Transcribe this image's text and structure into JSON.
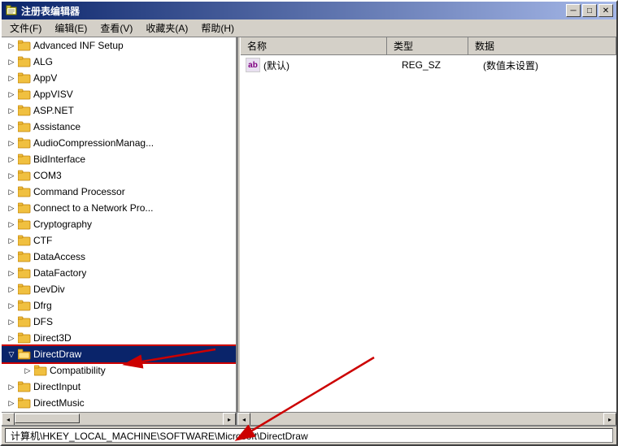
{
  "window": {
    "title": "注册表编辑器",
    "icon": "🗂"
  },
  "menu": {
    "items": [
      {
        "label": "文件(F)"
      },
      {
        "label": "编辑(E)"
      },
      {
        "label": "查看(V)"
      },
      {
        "label": "收藏夹(A)"
      },
      {
        "label": "帮助(H)"
      }
    ]
  },
  "tree": {
    "items": [
      {
        "label": "Advanced INF Setup",
        "indent": 1,
        "expanded": false
      },
      {
        "label": "ALG",
        "indent": 1,
        "expanded": false
      },
      {
        "label": "AppV",
        "indent": 1,
        "expanded": false
      },
      {
        "label": "AppVISV",
        "indent": 1,
        "expanded": false
      },
      {
        "label": "ASP.NET",
        "indent": 1,
        "expanded": false
      },
      {
        "label": "Assistance",
        "indent": 1,
        "expanded": false
      },
      {
        "label": "AudioCompressionManag...",
        "indent": 1,
        "expanded": false
      },
      {
        "label": "BidInterface",
        "indent": 1,
        "expanded": false
      },
      {
        "label": "COM3",
        "indent": 1,
        "expanded": false
      },
      {
        "label": "Command Processor",
        "indent": 1,
        "expanded": false
      },
      {
        "label": "Connect to a Network Pro...",
        "indent": 1,
        "expanded": false
      },
      {
        "label": "Cryptography",
        "indent": 1,
        "expanded": false
      },
      {
        "label": "CTF",
        "indent": 1,
        "expanded": false
      },
      {
        "label": "DataAccess",
        "indent": 1,
        "expanded": false
      },
      {
        "label": "DataFactory",
        "indent": 1,
        "expanded": false
      },
      {
        "label": "DevDiv",
        "indent": 1,
        "expanded": false
      },
      {
        "label": "Dfrg",
        "indent": 1,
        "expanded": false
      },
      {
        "label": "DFS",
        "indent": 1,
        "expanded": false
      },
      {
        "label": "Direct3D",
        "indent": 1,
        "expanded": false
      },
      {
        "label": "DirectDraw",
        "indent": 1,
        "expanded": true,
        "selected": true
      },
      {
        "label": "Compatibility",
        "indent": 2,
        "expanded": false
      },
      {
        "label": "DirectInput",
        "indent": 1,
        "expanded": false
      },
      {
        "label": "DirectMusic",
        "indent": 1,
        "expanded": false
      }
    ]
  },
  "right_panel": {
    "columns": [
      {
        "label": "名称",
        "key": "name"
      },
      {
        "label": "类型",
        "key": "type"
      },
      {
        "label": "数据",
        "key": "data"
      }
    ],
    "rows": [
      {
        "name": "(默认)",
        "type": "REG_SZ",
        "data": "(数值未设置)",
        "icon": "ab"
      }
    ]
  },
  "status": {
    "path": "计算机\\HKEY_LOCAL_MACHINE\\SOFTWARE\\Microsoft\\DirectDraw"
  },
  "titlebar_buttons": {
    "minimize": "─",
    "restore": "□",
    "close": "✕"
  }
}
